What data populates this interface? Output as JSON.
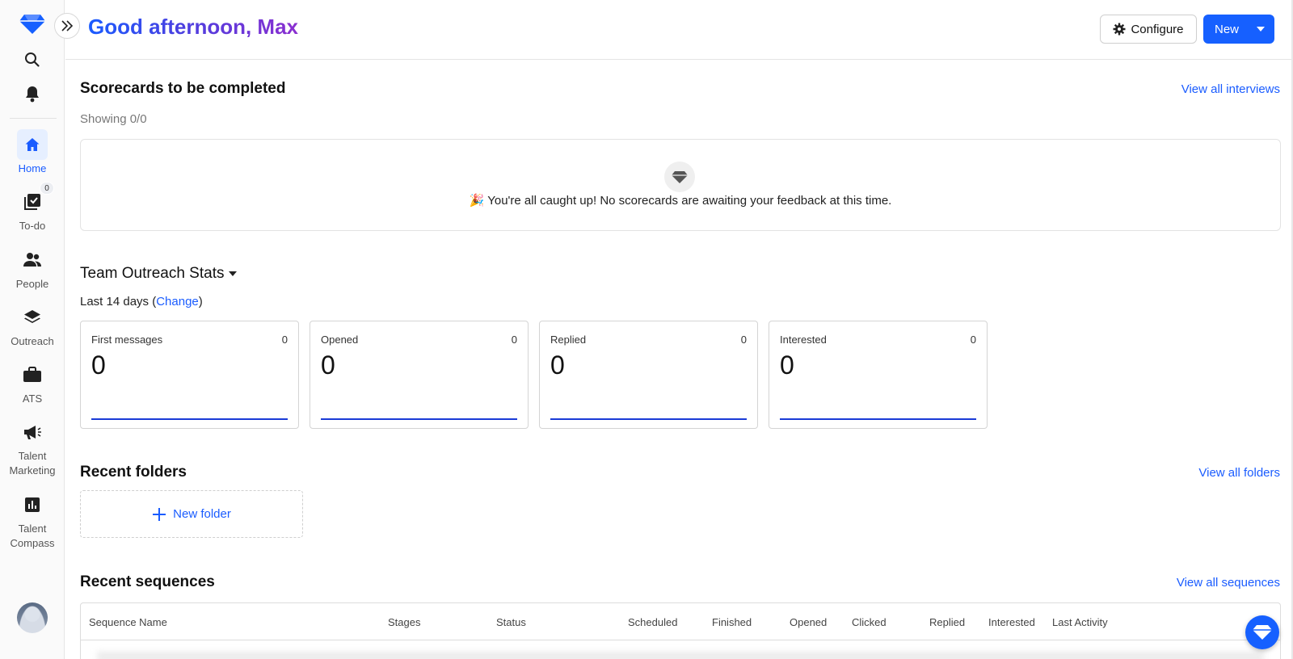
{
  "colors": {
    "accent": "#1660ff",
    "greeting_start": "#1a5cff",
    "greeting_end": "#8b2fd0",
    "sparkline": "#1a3bd6"
  },
  "sidebar": {
    "icons": [
      "gem-logo-icon",
      "expand-icon",
      "search-icon",
      "bell-icon"
    ],
    "items": [
      {
        "label": "Home",
        "icon": "home-icon",
        "active": true
      },
      {
        "label": "To-do",
        "icon": "checklist-icon",
        "badge": "0"
      },
      {
        "label": "People",
        "icon": "people-icon"
      },
      {
        "label": "Outreach",
        "icon": "layers-icon"
      },
      {
        "label": "ATS",
        "icon": "briefcase-icon"
      },
      {
        "label": "Talent\nMarketing",
        "icon": "megaphone-icon"
      },
      {
        "label": "Talent\nCompass",
        "icon": "bar-chart-icon"
      }
    ]
  },
  "header": {
    "greeting": "Good afternoon, Max",
    "configure_label": "Configure",
    "new_label": "New"
  },
  "scorecards": {
    "title": "Scorecards to be completed",
    "view_all": "View all interviews",
    "showing": "Showing 0/0",
    "empty_message": "🎉 You're all caught up! No scorecards are awaiting your feedback at this time."
  },
  "outreach": {
    "title": "Team Outreach Stats",
    "period_prefix": "Last 14 days (",
    "change_link": "Change",
    "period_suffix": ")",
    "stats": [
      {
        "name": "First messages",
        "count": "0",
        "value": "0"
      },
      {
        "name": "Opened",
        "count": "0",
        "value": "0"
      },
      {
        "name": "Replied",
        "count": "0",
        "value": "0"
      },
      {
        "name": "Interested",
        "count": "0",
        "value": "0"
      }
    ]
  },
  "folders": {
    "title": "Recent folders",
    "view_all": "View all folders",
    "new_folder": "New folder"
  },
  "sequences": {
    "title": "Recent sequences",
    "view_all": "View all sequences",
    "columns": [
      "Sequence Name",
      "Stages",
      "Status",
      "Scheduled",
      "Finished",
      "Opened",
      "Clicked",
      "Replied",
      "Interested",
      "Last Activity"
    ]
  }
}
